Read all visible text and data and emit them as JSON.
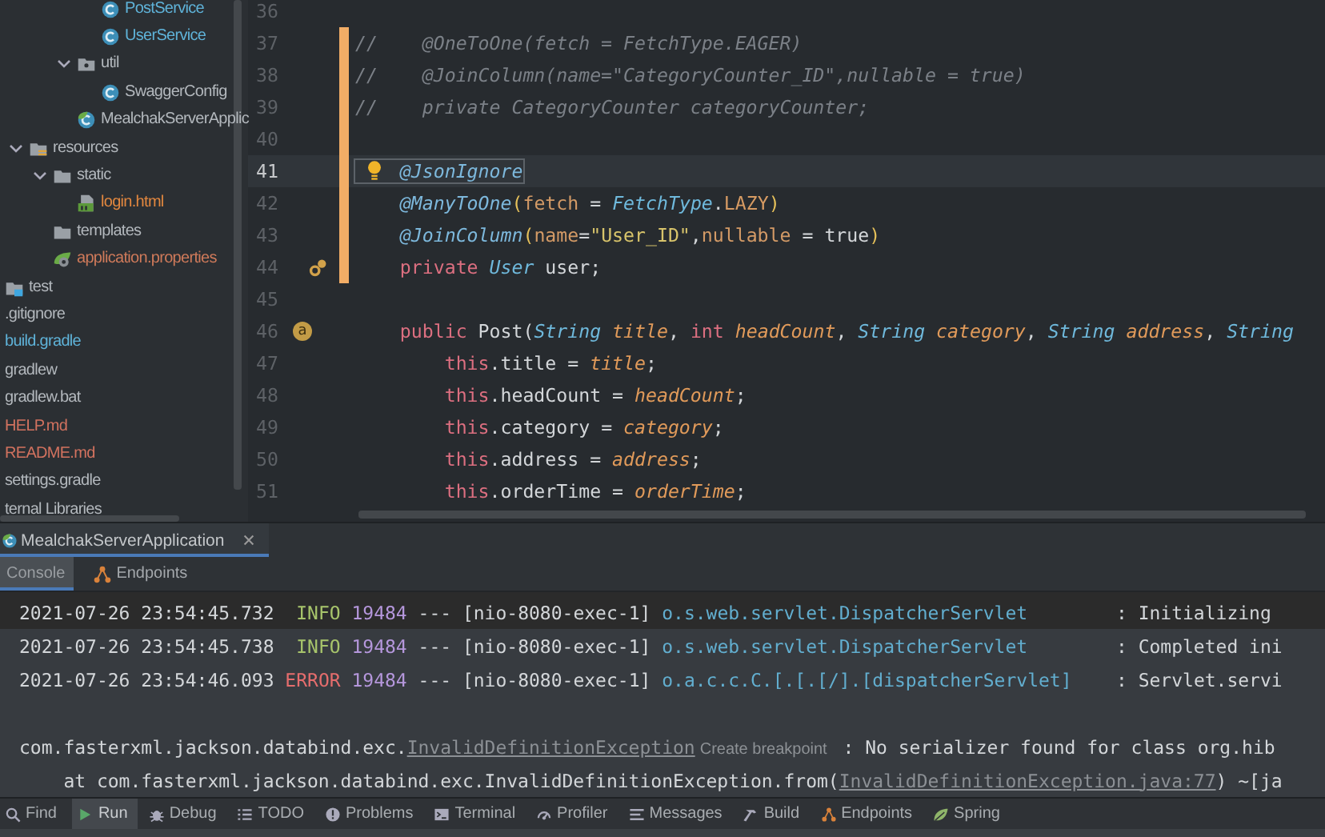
{
  "project_tree": [
    {
      "children": [
        {
          "children": [
            {
              "children": [
                {
                  "children": [
                    {
                      "label": "PostService",
                      "kind": "class",
                      "color": "#5fb3d9"
                    },
                    {
                      "label": "UserService",
                      "kind": "class",
                      "color": "#5fb3d9"
                    }
                  ]
                },
                {
                  "label": "util",
                  "kind": "package",
                  "expanded": true,
                  "children": [
                    {
                      "label": "SwaggerConfig",
                      "kind": "class"
                    }
                  ]
                },
                {
                  "label": "MealchakServerApplic",
                  "kind": "spring-class"
                }
              ]
            }
          ]
        },
        {
          "label": "resources",
          "kind": "resources-folder",
          "expanded": true,
          "children": [
            {
              "label": "static",
              "kind": "folder",
              "expanded": true,
              "children": [
                {
                  "label": "login.html",
                  "kind": "html",
                  "color": "#e2873f"
                }
              ]
            },
            {
              "label": "templates",
              "kind": "folder"
            },
            {
              "label": "application.properties",
              "kind": "spring-properties",
              "color": "#cf7a5a"
            }
          ]
        }
      ]
    },
    {
      "label": "test",
      "kind": "test-folder"
    },
    {
      "label": ".gitignore"
    },
    {
      "label": "build.gradle",
      "color": "#5fb3d9"
    },
    {
      "label": "gradlew"
    },
    {
      "label": "gradlew.bat"
    },
    {
      "label": "HELP.md",
      "color": "#d2725f"
    },
    {
      "label": "README.md",
      "color": "#d2725f"
    },
    {
      "label": "settings.gradle"
    },
    {
      "label": "ternal Libraries"
    }
  ],
  "editor": {
    "lines": [
      {
        "number": "36",
        "current": false,
        "changed": false
      },
      {
        "number": "37",
        "current": false,
        "changed": true,
        "tokens": [
          {
            "t": "//    @OneToOne(fetch = FetchType.EAGER)",
            "kind": "comment"
          }
        ]
      },
      {
        "number": "38",
        "current": false,
        "changed": true,
        "tokens": [
          {
            "t": "//    @JoinColumn(name=\"CategoryCounter_ID\",nullable = true)",
            "kind": "comment"
          }
        ]
      },
      {
        "number": "39",
        "current": false,
        "changed": true,
        "tokens": [
          {
            "t": "//    private CategoryCounter categoryCounter;",
            "kind": "comment"
          }
        ]
      },
      {
        "number": "40",
        "current": false,
        "changed": true
      },
      {
        "number": "41",
        "current": true,
        "changed": true,
        "bulb": true,
        "tokens": [
          {
            "t": "    @JsonIgnore",
            "kind": "annotation-boxed"
          }
        ]
      },
      {
        "number": "42",
        "current": false,
        "changed": true,
        "tokens": [
          {
            "t": "    @ManyToOne",
            "kind": "annotation"
          },
          {
            "t": "(",
            "kind": "paren"
          },
          {
            "t": "fetch",
            "kind": "attr"
          },
          {
            "t": " = ",
            "kind": "plain"
          },
          {
            "t": "FetchType",
            "kind": "type"
          },
          {
            "t": ".",
            "kind": "plain"
          },
          {
            "t": "LAZY",
            "kind": "constant"
          },
          {
            "t": ")",
            "kind": "paren"
          }
        ]
      },
      {
        "number": "43",
        "current": false,
        "changed": true,
        "tokens": [
          {
            "t": "    @JoinColumn",
            "kind": "annotation"
          },
          {
            "t": "(",
            "kind": "paren"
          },
          {
            "t": "name",
            "kind": "attr"
          },
          {
            "t": "=",
            "kind": "plain"
          },
          {
            "t": "\"User_ID\"",
            "kind": "string"
          },
          {
            "t": ",",
            "kind": "plain"
          },
          {
            "t": "nullable",
            "kind": "attr"
          },
          {
            "t": " = true",
            "kind": "plain"
          },
          {
            "t": ")",
            "kind": "paren"
          }
        ]
      },
      {
        "number": "44",
        "current": false,
        "changed": true,
        "gutter": {
          "kind": "link"
        },
        "tokens": [
          {
            "t": "    private ",
            "kind": "keyword"
          },
          {
            "t": "User",
            "kind": "type"
          },
          {
            "t": " user;",
            "kind": "plain"
          }
        ]
      },
      {
        "number": "45",
        "current": false,
        "changed": false
      },
      {
        "number": "46",
        "current": false,
        "changed": false,
        "gutter": {
          "kind": "badge",
          "text": "a"
        },
        "tokens": [
          {
            "t": "    public",
            "kind": "keyword"
          },
          {
            "t": " Post(",
            "kind": "plain"
          },
          {
            "t": "String ",
            "kind": "type"
          },
          {
            "t": "title",
            "kind": "param"
          },
          {
            "t": ", ",
            "kind": "plain"
          },
          {
            "t": "int ",
            "kind": "keyword"
          },
          {
            "t": "headCount",
            "kind": "param"
          },
          {
            "t": ", ",
            "kind": "plain"
          },
          {
            "t": "String ",
            "kind": "type"
          },
          {
            "t": "category",
            "kind": "param"
          },
          {
            "t": ", ",
            "kind": "plain"
          },
          {
            "t": "String ",
            "kind": "type"
          },
          {
            "t": "address",
            "kind": "param"
          },
          {
            "t": ", ",
            "kind": "plain"
          },
          {
            "t": "String",
            "kind": "type"
          }
        ]
      },
      {
        "number": "47",
        "current": false,
        "changed": false,
        "tokens": [
          {
            "t": "        this",
            "kind": "keyword"
          },
          {
            "t": ".title = ",
            "kind": "plain"
          },
          {
            "t": "title",
            "kind": "param"
          },
          {
            "t": ";",
            "kind": "plain"
          }
        ]
      },
      {
        "number": "48",
        "current": false,
        "changed": false,
        "tokens": [
          {
            "t": "        this",
            "kind": "keyword"
          },
          {
            "t": ".headCount = ",
            "kind": "plain"
          },
          {
            "t": "headCount",
            "kind": "param"
          },
          {
            "t": ";",
            "kind": "plain"
          }
        ]
      },
      {
        "number": "49",
        "current": false,
        "changed": false,
        "tokens": [
          {
            "t": "        this",
            "kind": "keyword"
          },
          {
            "t": ".category = ",
            "kind": "plain"
          },
          {
            "t": "category",
            "kind": "param"
          },
          {
            "t": ";",
            "kind": "plain"
          }
        ]
      },
      {
        "number": "50",
        "current": false,
        "changed": false,
        "tokens": [
          {
            "t": "        this",
            "kind": "keyword"
          },
          {
            "t": ".address = ",
            "kind": "plain"
          },
          {
            "t": "address",
            "kind": "param"
          },
          {
            "t": ";",
            "kind": "plain"
          }
        ]
      },
      {
        "number": "51",
        "current": false,
        "changed": false,
        "tokens": [
          {
            "t": "        this",
            "kind": "keyword"
          },
          {
            "t": ".orderTime = ",
            "kind": "plain"
          },
          {
            "t": "orderTime",
            "kind": "param"
          },
          {
            "t": ";",
            "kind": "plain"
          }
        ]
      }
    ]
  },
  "run_tab": {
    "label": "MealchakServerApplication"
  },
  "console_tabs": [
    {
      "label": "Console",
      "selected": true
    },
    {
      "label": "Endpoints",
      "selected": false,
      "kind": "endpoints"
    }
  ],
  "console": [
    {
      "highlighted": false,
      "tokens": [
        {
          "t": "2021-07-26 23:54:45.732  ",
          "kind": "plain"
        },
        {
          "t": "INFO",
          "kind": "info"
        },
        {
          "t": " 19484",
          "kind": "pid"
        },
        {
          "t": " --- [nio-8080-exec-1] ",
          "kind": "plain"
        },
        {
          "t": "o.s.web.servlet.DispatcherServlet",
          "kind": "logger"
        },
        {
          "t": "        : Initializing",
          "kind": "plain"
        }
      ]
    },
    {
      "highlighted": true,
      "tokens": [
        {
          "t": "2021-07-26 23:54:45.738  ",
          "kind": "plain"
        },
        {
          "t": "INFO",
          "kind": "info"
        },
        {
          "t": " 19484",
          "kind": "pid"
        },
        {
          "t": " --- [nio-8080-exec-1] ",
          "kind": "plain"
        },
        {
          "t": "o.s.web.servlet.DispatcherServlet",
          "kind": "logger"
        },
        {
          "t": "        : Completed ini",
          "kind": "plain"
        }
      ]
    },
    {
      "highlighted": true,
      "tokens": [
        {
          "t": "2021-07-26 23:54:46.093 ",
          "kind": "plain"
        },
        {
          "t": "ERROR",
          "kind": "error"
        },
        {
          "t": " 19484",
          "kind": "pid"
        },
        {
          "t": " --- [nio-8080-exec-1] ",
          "kind": "plain"
        },
        {
          "t": "o.a.c.c.C.[.[.[/].[dispatcherServlet]",
          "kind": "logger"
        },
        {
          "t": "    : Servlet.servi",
          "kind": "plain"
        }
      ]
    },
    {
      "highlighted": true
    },
    {
      "highlighted": true,
      "tokens": [
        {
          "t": "com.fasterxml.jackson.databind.exc.",
          "kind": "plain"
        },
        {
          "t": "InvalidDefinitionException",
          "kind": "link"
        },
        {
          "t": "Create breakpoint",
          "kind": "hint"
        },
        {
          "t": " : No serializer found for class org.hib",
          "kind": "plain"
        }
      ]
    },
    {
      "highlighted": true,
      "tokens": [
        {
          "t": "    at com.fasterxml.jackson.databind.exc.InvalidDefinitionException.from(",
          "kind": "plain"
        },
        {
          "t": "InvalidDefinitionException.java:77",
          "kind": "link"
        },
        {
          "t": ") ~[ja",
          "kind": "plain"
        }
      ]
    }
  ],
  "tool_windows": [
    {
      "label": "Find",
      "kind": "search",
      "selected": false
    },
    {
      "label": "Run",
      "kind": "run",
      "selected": true
    },
    {
      "label": "Debug",
      "kind": "bug",
      "selected": false
    },
    {
      "label": "TODO",
      "kind": "list",
      "selected": false
    },
    {
      "label": "Problems",
      "kind": "info",
      "selected": false
    },
    {
      "label": "Terminal",
      "kind": "terminal",
      "selected": false
    },
    {
      "label": "Profiler",
      "kind": "gauge",
      "selected": false
    },
    {
      "label": "Messages",
      "kind": "lines",
      "selected": false
    },
    {
      "label": "Build",
      "kind": "hammer",
      "selected": false
    },
    {
      "label": "Endpoints",
      "kind": "endpoints",
      "selected": false
    },
    {
      "label": "Spring",
      "kind": "leaf",
      "selected": false
    }
  ]
}
